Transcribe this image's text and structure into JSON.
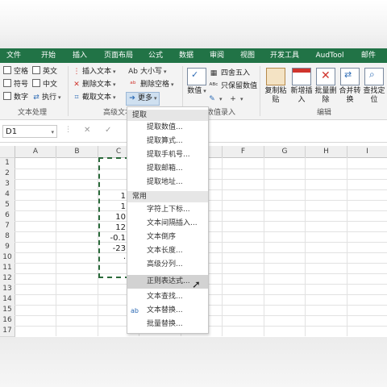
{
  "tabs": [
    "文件",
    "开始",
    "插入",
    "页面布局",
    "公式",
    "数据",
    "审阅",
    "视图",
    "开发工具",
    "AudTool",
    "邮件"
  ],
  "ribbon": {
    "col1": [
      {
        "label": "空格"
      },
      {
        "label": "符号"
      },
      {
        "label": "数字"
      }
    ],
    "col2": [
      {
        "label": "英文"
      },
      {
        "label": "中文"
      },
      {
        "label": "执行"
      }
    ],
    "col3": [
      {
        "label": "插入文本"
      },
      {
        "label": "删除文本"
      },
      {
        "label": "截取文本"
      }
    ],
    "col4": [
      {
        "label": "大小写"
      },
      {
        "label": "删除空格"
      },
      {
        "label": "更多"
      }
    ],
    "number_label": "数值",
    "round_label": "四舍五入",
    "keep_value_label": "只保留数值",
    "big_buttons": [
      {
        "label": "复制粘\n贴"
      },
      {
        "label": "新增插\n入"
      },
      {
        "label": "批量删\n除"
      },
      {
        "label": "合并转\n换"
      },
      {
        "label": "查找定\n位"
      }
    ],
    "groups": {
      "text_processing": "文本处理",
      "advanced_text": "高级文本",
      "data_entry": "数值录入",
      "edit": "编辑"
    }
  },
  "formula_bar": {
    "name_box": "D1",
    "cancel": "✕",
    "confirm": "✓"
  },
  "columns": [
    "A",
    "B",
    "C",
    "D",
    "E",
    "F",
    "G",
    "H",
    "I"
  ],
  "rows": [
    "1",
    "2",
    "3",
    "4",
    "5",
    "6",
    "7",
    "8",
    "9",
    "10",
    "11",
    "12",
    "13",
    "14",
    "15",
    "16",
    "17"
  ],
  "cells": [
    {
      "row": 4,
      "text": "1"
    },
    {
      "row": 5,
      "text": "1"
    },
    {
      "row": 6,
      "text": "10"
    },
    {
      "row": 7,
      "text": "12"
    },
    {
      "row": 8,
      "text": "-0.1"
    },
    {
      "row": 9,
      "text": "-23"
    },
    {
      "row": 10,
      "text": "·"
    }
  ],
  "menu": {
    "section1": "提取",
    "extract_items": [
      "提取数值...",
      "提取算式...",
      "提取手机号...",
      "提取邮箱...",
      "提取地址..."
    ],
    "section2": "常用",
    "common_items": [
      "字符上下标...",
      "文本间隔插入...",
      "文本倒序",
      "文本长度...",
      "高级分列...",
      "正则表达式...",
      "文本查找...",
      "文本替换...",
      "批量替换..."
    ],
    "selected": "正则表达式..."
  }
}
